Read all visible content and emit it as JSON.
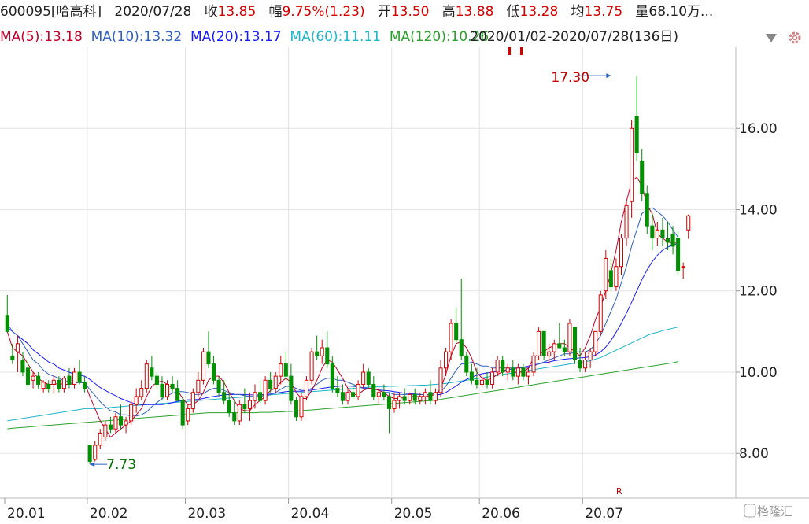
{
  "header": {
    "code": "600095[哈高科]",
    "date": "2020/07/28",
    "close_label": "收",
    "close_value": "13.85",
    "change_label": "幅",
    "change_value": "9.75%(1.23)",
    "open_label": "开",
    "open_value": "13.50",
    "high_label": "高",
    "high_value": "13.88",
    "low_label": "低",
    "low_value": "13.28",
    "avg_label": "均",
    "avg_value": "13.75",
    "volume_label": "量",
    "volume_value": "68.10万..."
  },
  "ma_bar": {
    "ma5": "MA(5):13.18",
    "ma10": "MA(10):13.32",
    "ma20": "MA(20):13.17",
    "ma60": "MA(60):11.11",
    "ma120": "MA(120):10.26",
    "range": "2020/01/02-2020/07/28(136日)",
    "dropdown_icon": "triangle-down-icon",
    "settings_icon": "gear-icon"
  },
  "colors": {
    "up": "#d40000",
    "down": "#009000",
    "ma5": "#c0002a",
    "ma10": "#3060c0",
    "ma20": "#1a1aff",
    "ma60": "#1fb5c8",
    "ma120": "#2ca02c"
  },
  "watermark": "格隆汇",
  "chart_data": {
    "type": "candlestick",
    "ylim": [
      6.9,
      18.0
    ],
    "yticks": [
      "8.00",
      "10.00",
      "12.00",
      "14.00",
      "16.00"
    ],
    "ytick_values": [
      8,
      10,
      12,
      14,
      16
    ],
    "months": [
      "20.01",
      "20.02",
      "20.03",
      "20.04",
      "20.05",
      "20.06",
      "20.07"
    ],
    "month_start_index": [
      0,
      16,
      35,
      55,
      75,
      92,
      112
    ],
    "annotations": [
      {
        "text": "17.30",
        "index": 117,
        "value": 17.3,
        "color": "#c00000"
      },
      {
        "text": "7.73",
        "index": 16,
        "value": 7.73,
        "color": "#007000"
      }
    ],
    "marker_text": "R",
    "candles": [
      [
        11.4,
        11.9,
        11.0,
        11.0
      ],
      [
        10.4,
        10.7,
        10.2,
        10.3
      ],
      [
        10.5,
        10.9,
        10.0,
        10.7
      ],
      [
        10.3,
        10.5,
        9.9,
        10.0
      ],
      [
        10.1,
        10.3,
        9.6,
        9.7
      ],
      [
        9.8,
        10.0,
        9.6,
        9.9
      ],
      [
        9.9,
        10.0,
        9.6,
        9.7
      ],
      [
        9.6,
        9.8,
        9.5,
        9.75
      ],
      [
        9.7,
        9.8,
        9.5,
        9.6
      ],
      [
        9.7,
        9.9,
        9.5,
        9.8
      ],
      [
        9.8,
        9.9,
        9.5,
        9.6
      ],
      [
        9.6,
        9.9,
        9.5,
        9.85
      ],
      [
        9.9,
        10.1,
        9.6,
        9.7
      ],
      [
        9.7,
        10.1,
        9.6,
        10.0
      ],
      [
        10.0,
        10.3,
        9.7,
        9.75
      ],
      [
        9.75,
        9.9,
        9.5,
        9.6
      ],
      [
        8.2,
        8.2,
        7.73,
        7.8
      ],
      [
        7.85,
        8.3,
        7.8,
        8.2
      ],
      [
        8.2,
        8.6,
        8.1,
        8.5
      ],
      [
        8.4,
        8.8,
        8.3,
        8.7
      ],
      [
        8.7,
        8.9,
        8.5,
        8.6
      ],
      [
        8.6,
        9.0,
        8.5,
        8.9
      ],
      [
        8.9,
        9.2,
        8.6,
        8.7
      ],
      [
        8.7,
        8.9,
        8.5,
        8.8
      ],
      [
        8.8,
        9.3,
        8.7,
        9.2
      ],
      [
        9.2,
        9.6,
        9.0,
        9.4
      ],
      [
        9.4,
        9.8,
        9.3,
        9.6
      ],
      [
        9.6,
        10.3,
        9.5,
        10.2
      ],
      [
        10.1,
        10.4,
        9.8,
        9.9
      ],
      [
        9.9,
        10.0,
        9.6,
        9.7
      ],
      [
        9.7,
        9.9,
        9.3,
        9.4
      ],
      [
        9.4,
        9.8,
        9.3,
        9.7
      ],
      [
        9.7,
        9.9,
        9.5,
        9.6
      ],
      [
        9.6,
        9.8,
        9.3,
        9.3
      ],
      [
        9.3,
        9.4,
        8.6,
        8.7
      ],
      [
        8.8,
        9.2,
        8.7,
        9.1
      ],
      [
        9.1,
        9.6,
        9.0,
        9.5
      ],
      [
        9.5,
        10.0,
        9.4,
        9.8
      ],
      [
        9.8,
        10.6,
        9.7,
        10.5
      ],
      [
        10.5,
        11.0,
        10.1,
        10.2
      ],
      [
        10.2,
        10.4,
        9.7,
        9.8
      ],
      [
        9.8,
        9.9,
        9.4,
        9.5
      ],
      [
        9.5,
        9.8,
        9.2,
        9.3
      ],
      [
        9.3,
        9.5,
        8.9,
        9.0
      ],
      [
        9.0,
        9.3,
        8.7,
        8.8
      ],
      [
        8.8,
        9.3,
        8.7,
        9.2
      ],
      [
        9.2,
        9.6,
        9.0,
        9.1
      ],
      [
        9.1,
        9.5,
        8.8,
        9.3
      ],
      [
        9.3,
        9.7,
        9.1,
        9.5
      ],
      [
        9.5,
        9.8,
        9.2,
        9.3
      ],
      [
        9.3,
        9.9,
        9.2,
        9.8
      ],
      [
        9.8,
        10.0,
        9.5,
        9.6
      ],
      [
        9.6,
        10.0,
        9.5,
        9.9
      ],
      [
        9.9,
        10.4,
        9.7,
        10.2
      ],
      [
        10.2,
        10.5,
        9.8,
        9.9
      ],
      [
        9.9,
        10.2,
        9.2,
        9.3
      ],
      [
        9.3,
        9.4,
        8.8,
        8.9
      ],
      [
        8.9,
        9.5,
        8.8,
        9.4
      ],
      [
        9.4,
        9.9,
        9.3,
        9.8
      ],
      [
        9.8,
        10.6,
        9.7,
        10.5
      ],
      [
        10.5,
        10.9,
        10.3,
        10.4
      ],
      [
        10.4,
        10.8,
        10.2,
        10.6
      ],
      [
        10.6,
        11.0,
        10.1,
        10.2
      ],
      [
        10.2,
        10.4,
        9.5,
        9.6
      ],
      [
        9.6,
        9.9,
        9.4,
        9.5
      ],
      [
        9.5,
        9.7,
        9.2,
        9.3
      ],
      [
        9.3,
        9.6,
        9.2,
        9.5
      ],
      [
        9.5,
        9.7,
        9.3,
        9.4
      ],
      [
        9.4,
        9.8,
        9.3,
        9.7
      ],
      [
        9.7,
        10.2,
        9.6,
        10.0
      ],
      [
        10.0,
        10.1,
        9.6,
        9.7
      ],
      [
        9.7,
        9.9,
        9.3,
        9.4
      ],
      [
        9.4,
        9.6,
        9.2,
        9.5
      ],
      [
        9.5,
        9.7,
        9.3,
        9.4
      ],
      [
        9.4,
        9.5,
        8.5,
        9.1
      ],
      [
        9.1,
        9.5,
        9.0,
        9.3
      ],
      [
        9.3,
        9.5,
        9.1,
        9.4
      ],
      [
        9.4,
        9.6,
        9.2,
        9.3
      ],
      [
        9.3,
        9.5,
        9.2,
        9.45
      ],
      [
        9.45,
        9.6,
        9.2,
        9.3
      ],
      [
        9.3,
        9.5,
        9.2,
        9.4
      ],
      [
        9.4,
        9.6,
        9.2,
        9.5
      ],
      [
        9.5,
        9.8,
        9.2,
        9.3
      ],
      [
        9.3,
        9.6,
        9.2,
        9.5
      ],
      [
        9.5,
        10.3,
        9.4,
        10.1
      ],
      [
        10.1,
        10.6,
        9.9,
        10.5
      ],
      [
        10.5,
        11.3,
        10.3,
        11.2
      ],
      [
        11.2,
        11.6,
        10.7,
        10.8
      ],
      [
        10.8,
        12.3,
        10.3,
        10.4
      ],
      [
        10.4,
        10.5,
        9.9,
        10.0
      ],
      [
        10.0,
        10.2,
        9.7,
        9.8
      ],
      [
        9.8,
        10.1,
        9.6,
        9.7
      ],
      [
        9.7,
        9.9,
        9.6,
        9.8
      ],
      [
        9.8,
        10.0,
        9.6,
        9.7
      ],
      [
        9.7,
        10.1,
        9.6,
        10.0
      ],
      [
        10.0,
        10.4,
        9.9,
        10.3
      ],
      [
        10.3,
        10.4,
        9.9,
        10.0
      ],
      [
        10.0,
        10.2,
        9.8,
        10.1
      ],
      [
        10.1,
        10.3,
        9.8,
        9.9
      ],
      [
        9.9,
        10.2,
        9.7,
        10.1
      ],
      [
        10.1,
        10.2,
        9.8,
        9.9
      ],
      [
        9.9,
        10.1,
        9.7,
        10.0
      ],
      [
        10.0,
        10.5,
        9.9,
        10.4
      ],
      [
        10.4,
        11.1,
        10.3,
        11.0
      ],
      [
        11.0,
        11.0,
        10.3,
        10.4
      ],
      [
        10.4,
        10.7,
        10.2,
        10.5
      ],
      [
        10.5,
        10.8,
        10.3,
        10.7
      ],
      [
        10.7,
        11.2,
        10.6,
        10.6
      ],
      [
        10.6,
        10.8,
        10.4,
        10.5
      ],
      [
        10.5,
        11.3,
        10.4,
        11.2
      ],
      [
        11.1,
        11.1,
        10.2,
        10.3
      ],
      [
        10.3,
        10.6,
        10.0,
        10.1
      ],
      [
        10.1,
        10.5,
        10.0,
        10.3
      ],
      [
        10.3,
        10.6,
        10.1,
        10.5
      ],
      [
        10.5,
        11.0,
        10.4,
        11.0
      ],
      [
        11.0,
        12.0,
        10.9,
        11.9
      ],
      [
        12.0,
        13.0,
        11.8,
        12.8
      ],
      [
        12.5,
        12.8,
        12.0,
        12.1
      ],
      [
        12.1,
        12.8,
        12.0,
        12.6
      ],
      [
        12.6,
        13.4,
        12.4,
        13.3
      ],
      [
        13.3,
        14.2,
        13.1,
        14.1
      ],
      [
        14.2,
        16.2,
        13.8,
        16.0
      ],
      [
        16.3,
        17.3,
        15.2,
        15.4
      ],
      [
        15.2,
        15.5,
        14.2,
        14.4
      ],
      [
        14.4,
        14.6,
        13.4,
        13.6
      ],
      [
        13.6,
        13.9,
        13.0,
        13.3
      ],
      [
        13.3,
        13.7,
        13.1,
        13.5
      ],
      [
        13.5,
        13.8,
        13.1,
        13.3
      ],
      [
        13.3,
        13.7,
        13.0,
        13.2
      ],
      [
        13.4,
        13.6,
        12.9,
        13.1
      ],
      [
        13.3,
        13.5,
        12.4,
        12.5
      ],
      [
        12.6,
        12.7,
        12.3,
        12.6
      ],
      [
        13.5,
        13.88,
        13.28,
        13.85
      ]
    ],
    "ma5": [
      11.0,
      10.6,
      10.5,
      10.4,
      10.2,
      10.0,
      9.85,
      9.75,
      9.7,
      9.7,
      9.72,
      9.7,
      9.7,
      9.72,
      9.78,
      9.73,
      9.4,
      9.1,
      8.8,
      8.6,
      8.4,
      8.5,
      8.6,
      8.7,
      8.8,
      8.95,
      9.1,
      9.4,
      9.65,
      9.75,
      9.78,
      9.7,
      9.6,
      9.55,
      9.35,
      9.2,
      9.2,
      9.3,
      9.5,
      9.8,
      9.9,
      9.9,
      9.75,
      9.5,
      9.3,
      9.1,
      9.05,
      9.05,
      9.2,
      9.3,
      9.4,
      9.55,
      9.6,
      9.75,
      9.85,
      9.75,
      9.5,
      9.35,
      9.35,
      9.55,
      9.8,
      10.1,
      10.3,
      10.25,
      10.05,
      9.85,
      9.6,
      9.45,
      9.45,
      9.55,
      9.6,
      9.6,
      9.55,
      9.5,
      9.4,
      9.35,
      9.35,
      9.38,
      9.4,
      9.4,
      9.4,
      9.4,
      9.42,
      9.45,
      9.6,
      9.95,
      10.4,
      10.7,
      10.75,
      10.6,
      10.35,
      10.0,
      9.85,
      9.8,
      9.85,
      9.95,
      10.0,
      10.05,
      10.0,
      10.0,
      10.0,
      10.1,
      10.35,
      10.45,
      10.5,
      10.6,
      10.65,
      10.7,
      10.7,
      10.6,
      10.5,
      10.4,
      10.6,
      10.9,
      11.3,
      11.6,
      12.0,
      12.45,
      13.0,
      13.7,
      14.2,
      14.7,
      14.8,
      14.6,
      14.1,
      13.9,
      13.4,
      13.3,
      13.2,
      13.18,
      13.18
    ],
    "ma10": [
      11.2,
      11.0,
      10.9,
      10.7,
      10.5,
      10.3,
      10.2,
      10.05,
      9.95,
      9.9,
      9.85,
      9.78,
      9.76,
      9.74,
      9.74,
      9.74,
      9.57,
      9.43,
      9.27,
      9.15,
      9.05,
      9.02,
      8.95,
      8.95,
      8.92,
      8.92,
      8.95,
      9.02,
      9.15,
      9.25,
      9.35,
      9.42,
      9.48,
      9.52,
      9.52,
      9.5,
      9.45,
      9.45,
      9.47,
      9.55,
      9.6,
      9.6,
      9.55,
      9.5,
      9.45,
      9.45,
      9.42,
      9.4,
      9.4,
      9.4,
      9.4,
      9.45,
      9.5,
      9.58,
      9.65,
      9.65,
      9.6,
      9.55,
      9.55,
      9.6,
      9.7,
      9.8,
      9.85,
      9.85,
      9.8,
      9.8,
      9.75,
      9.7,
      9.65,
      9.6,
      9.6,
      9.6,
      9.55,
      9.5,
      9.5,
      9.45,
      9.45,
      9.45,
      9.45,
      9.45,
      9.45,
      9.45,
      9.45,
      9.48,
      9.52,
      9.65,
      9.85,
      10.05,
      10.2,
      10.2,
      10.25,
      10.2,
      10.15,
      10.15,
      10.1,
      10.1,
      10.1,
      10.1,
      10.1,
      10.1,
      10.1,
      10.1,
      10.15,
      10.2,
      10.25,
      10.3,
      10.35,
      10.4,
      10.45,
      10.45,
      10.5,
      10.5,
      10.5,
      10.55,
      10.7,
      10.9,
      11.2,
      11.5,
      11.8,
      12.2,
      12.6,
      13.1,
      13.5,
      13.9,
      14.0,
      14.05,
      13.95,
      13.85,
      13.7,
      13.5,
      13.32
    ],
    "ma20": [
      11.1,
      11.0,
      10.9,
      10.8,
      10.7,
      10.55,
      10.45,
      10.35,
      10.25,
      10.2,
      10.1,
      10.05,
      10.0,
      9.95,
      9.92,
      9.9,
      9.82,
      9.72,
      9.62,
      9.55,
      9.48,
      9.42,
      9.35,
      9.3,
      9.25,
      9.22,
      9.2,
      9.2,
      9.2,
      9.2,
      9.2,
      9.22,
      9.25,
      9.28,
      9.3,
      9.32,
      9.32,
      9.33,
      9.35,
      9.38,
      9.4,
      9.42,
      9.44,
      9.45,
      9.45,
      9.45,
      9.45,
      9.44,
      9.44,
      9.44,
      9.45,
      9.46,
      9.48,
      9.5,
      9.52,
      9.53,
      9.53,
      9.53,
      9.54,
      9.56,
      9.58,
      9.6,
      9.62,
      9.64,
      9.65,
      9.66,
      9.66,
      9.65,
      9.64,
      9.62,
      9.6,
      9.58,
      9.56,
      9.55,
      9.54,
      9.52,
      9.5,
      9.48,
      9.47,
      9.46,
      9.45,
      9.44,
      9.44,
      9.44,
      9.45,
      9.5,
      9.58,
      9.66,
      9.75,
      9.82,
      9.88,
      9.92,
      9.96,
      9.98,
      10.0,
      10.02,
      10.04,
      10.06,
      10.08,
      10.1,
      10.12,
      10.15,
      10.18,
      10.2,
      10.23,
      10.25,
      10.28,
      10.3,
      10.32,
      10.33,
      10.34,
      10.35,
      10.36,
      10.38,
      10.42,
      10.5,
      10.62,
      10.78,
      10.98,
      11.2,
      11.45,
      11.72,
      12.0,
      12.28,
      12.52,
      12.72,
      12.88,
      13.0,
      13.08,
      13.13,
      13.17
    ],
    "ma60": [
      8.8,
      8.82,
      8.84,
      8.86,
      8.88,
      8.9,
      8.92,
      8.94,
      8.96,
      8.98,
      9.0,
      9.02,
      9.04,
      9.06,
      9.08,
      9.1,
      9.1,
      9.1,
      9.1,
      9.12,
      9.13,
      9.14,
      9.15,
      9.16,
      9.17,
      9.18,
      9.19,
      9.2,
      9.21,
      9.22,
      9.23,
      9.24,
      9.25,
      9.26,
      9.27,
      9.28,
      9.29,
      9.3,
      9.31,
      9.32,
      9.33,
      9.34,
      9.35,
      9.36,
      9.37,
      9.38,
      9.39,
      9.4,
      9.41,
      9.42,
      9.43,
      9.44,
      9.45,
      9.46,
      9.47,
      9.48,
      9.49,
      9.5,
      9.51,
      9.52,
      9.53,
      9.54,
      9.55,
      9.56,
      9.57,
      9.58,
      9.59,
      9.6,
      9.61,
      9.62,
      9.63,
      9.64,
      9.64,
      9.64,
      9.65,
      9.65,
      9.66,
      9.66,
      9.67,
      9.67,
      9.68,
      9.68,
      9.69,
      9.7,
      9.71,
      9.72,
      9.74,
      9.76,
      9.78,
      9.8,
      9.82,
      9.84,
      9.86,
      9.88,
      9.9,
      9.92,
      9.94,
      9.96,
      9.98,
      10.0,
      10.02,
      10.04,
      10.06,
      10.08,
      10.1,
      10.12,
      10.14,
      10.16,
      10.18,
      10.2,
      10.22,
      10.24,
      10.26,
      10.28,
      10.32,
      10.36,
      10.42,
      10.48,
      10.54,
      10.6,
      10.66,
      10.72,
      10.78,
      10.84,
      10.9,
      10.95,
      10.98,
      11.02,
      11.05,
      11.08,
      11.11
    ],
    "ma120": [
      8.6,
      8.62,
      8.63,
      8.64,
      8.65,
      8.66,
      8.67,
      8.68,
      8.69,
      8.7,
      8.71,
      8.72,
      8.73,
      8.74,
      8.75,
      8.76,
      8.77,
      8.78,
      8.79,
      8.8,
      8.81,
      8.82,
      8.83,
      8.84,
      8.85,
      8.86,
      8.87,
      8.88,
      8.89,
      8.9,
      8.91,
      8.92,
      8.93,
      8.94,
      8.95,
      8.96,
      8.97,
      8.98,
      8.99,
      9.0,
      9.0,
      9.0,
      9.0,
      9.0,
      9.0,
      9.0,
      9.0,
      9.0,
      9.0,
      9.01,
      9.01,
      9.01,
      9.02,
      9.02,
      9.03,
      9.03,
      9.04,
      9.05,
      9.06,
      9.07,
      9.08,
      9.09,
      9.1,
      9.11,
      9.12,
      9.13,
      9.14,
      9.15,
      9.16,
      9.17,
      9.18,
      9.19,
      9.2,
      9.21,
      9.22,
      9.23,
      9.24,
      9.25,
      9.26,
      9.27,
      9.28,
      9.29,
      9.3,
      9.31,
      9.33,
      9.35,
      9.37,
      9.39,
      9.41,
      9.43,
      9.45,
      9.47,
      9.49,
      9.51,
      9.53,
      9.55,
      9.57,
      9.59,
      9.61,
      9.63,
      9.65,
      9.67,
      9.69,
      9.71,
      9.73,
      9.75,
      9.77,
      9.79,
      9.81,
      9.83,
      9.85,
      9.87,
      9.89,
      9.91,
      9.93,
      9.95,
      9.97,
      9.99,
      10.01,
      10.03,
      10.05,
      10.07,
      10.09,
      10.11,
      10.13,
      10.15,
      10.17,
      10.19,
      10.21,
      10.23,
      10.26
    ]
  }
}
